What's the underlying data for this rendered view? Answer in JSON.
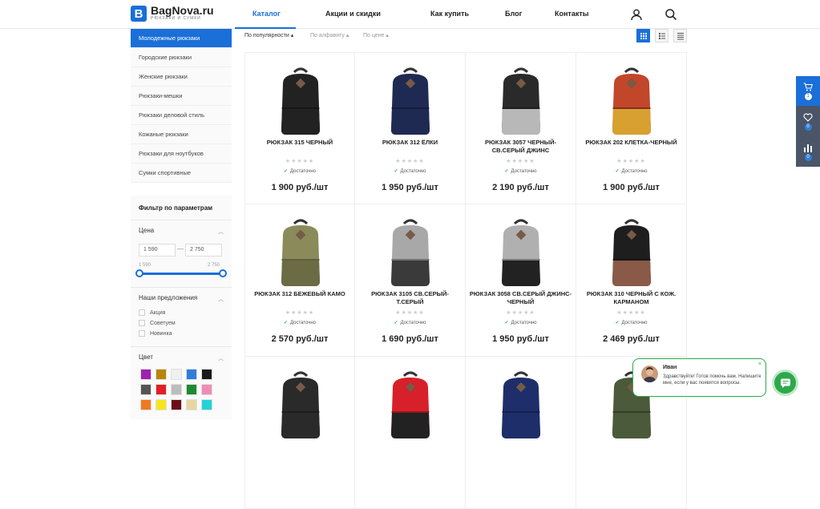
{
  "header": {
    "logo_letter": "B",
    "logo_title": "BagNova.ru",
    "logo_sub": "РЮКЗАКИ И СУМКИ",
    "nav": [
      "Каталог",
      "Акции и скидки",
      "Как купить",
      "Блог",
      "Контакты"
    ]
  },
  "categories": [
    "Молодежные рюкзаки",
    "Городские рюкзаки",
    "Женские рюкзаки",
    "Рюкзаки-мешки",
    "Рюкзаки деловой стиль",
    "Кожаные рюкзаки",
    "Рюкзаки для ноутбуков",
    "Сумки спортивные"
  ],
  "filter": {
    "title": "Фильтр по параметрам",
    "price_label": "Цена",
    "price_min": "1 590",
    "price_max": "2 750",
    "range_min": "1 590",
    "range_max": "2 750",
    "offers_label": "Наши предложения",
    "offers": [
      "Акция",
      "Советуем",
      "Новинка"
    ],
    "color_label": "Цвет",
    "colors": [
      "#a020b0",
      "#b8860b",
      "#f0f0f0",
      "#2f7fd8",
      "#1a1a1a",
      "#555555",
      "#e31e24",
      "#bdbdbd",
      "#1e8a2e",
      "#f08cb4",
      "#f07820",
      "#f5e61e",
      "#6b0f1a",
      "#e8d6a0",
      "#22d3d8"
    ]
  },
  "sort": {
    "options": [
      "По популярности",
      "По алфавиту",
      "По цене"
    ]
  },
  "products": [
    {
      "name": "Рюкзак 315 черный",
      "stars": "★★★★★",
      "availability": "Достаточно",
      "price": "1 900 руб./шт",
      "color": "#222",
      "bottom": "#222"
    },
    {
      "name": "Рюкзак 312 Ёлки",
      "stars": "★★★★★",
      "availability": "Достаточно",
      "price": "1 950 руб./шт",
      "color": "#1f2a52",
      "bottom": "#1f2a52"
    },
    {
      "name": "Рюкзак 3057 черный-св.серый джинс",
      "stars": "★★★★★",
      "availability": "Достаточно",
      "price": "2 190 руб./шт",
      "color": "#2a2a2a",
      "bottom": "#b8b8b8"
    },
    {
      "name": "Рюкзак 202 клетка-черный",
      "stars": "★★★★★",
      "availability": "Достаточно",
      "price": "1 900 руб./шт",
      "color": "#c2462a",
      "bottom": "#d8a030"
    },
    {
      "name": "Рюкзак 312 бежевый камо",
      "stars": "★★★★★",
      "availability": "Достаточно",
      "price": "2 570 руб./шт",
      "color": "#8a8a5a",
      "bottom": "#6b6b44"
    },
    {
      "name": "Рюкзак 3105 св.серый-т.серый",
      "stars": "★★★★★",
      "availability": "Достаточно",
      "price": "1 690 руб./шт",
      "color": "#a8a8a8",
      "bottom": "#3a3a3a"
    },
    {
      "name": "Рюкзак 3058 св.серый джинс-черный",
      "stars": "★★★★★",
      "availability": "Достаточно",
      "price": "1 950 руб./шт",
      "color": "#b0b0b0",
      "bottom": "#222"
    },
    {
      "name": "Рюкзак 310 черный с кож. карманом",
      "stars": "★★★★★",
      "availability": "Достаточно",
      "price": "2 469 руб./шт",
      "color": "#1e1e1e",
      "bottom": "#8a5a48"
    },
    {
      "name": "",
      "stars": "",
      "availability": "",
      "price": "",
      "color": "#2a2a2a",
      "bottom": "#2a2a2a"
    },
    {
      "name": "",
      "stars": "",
      "availability": "",
      "price": "",
      "color": "#d8202a",
      "bottom": "#222"
    },
    {
      "name": "",
      "stars": "",
      "availability": "",
      "price": "",
      "color": "#1e2e6a",
      "bottom": "#1e2e6a"
    },
    {
      "name": "",
      "stars": "",
      "availability": "",
      "price": "",
      "color": "#4a5a3a",
      "bottom": "#4a5a3a"
    }
  ],
  "side_panel": {
    "cart": "1",
    "wishlist": "0",
    "compare": "0"
  },
  "chat": {
    "name": "Иван",
    "message": "Здравствуйте! Готов помочь вам. Напишите мне, если у вас появятся вопросы.",
    "close": "×"
  }
}
